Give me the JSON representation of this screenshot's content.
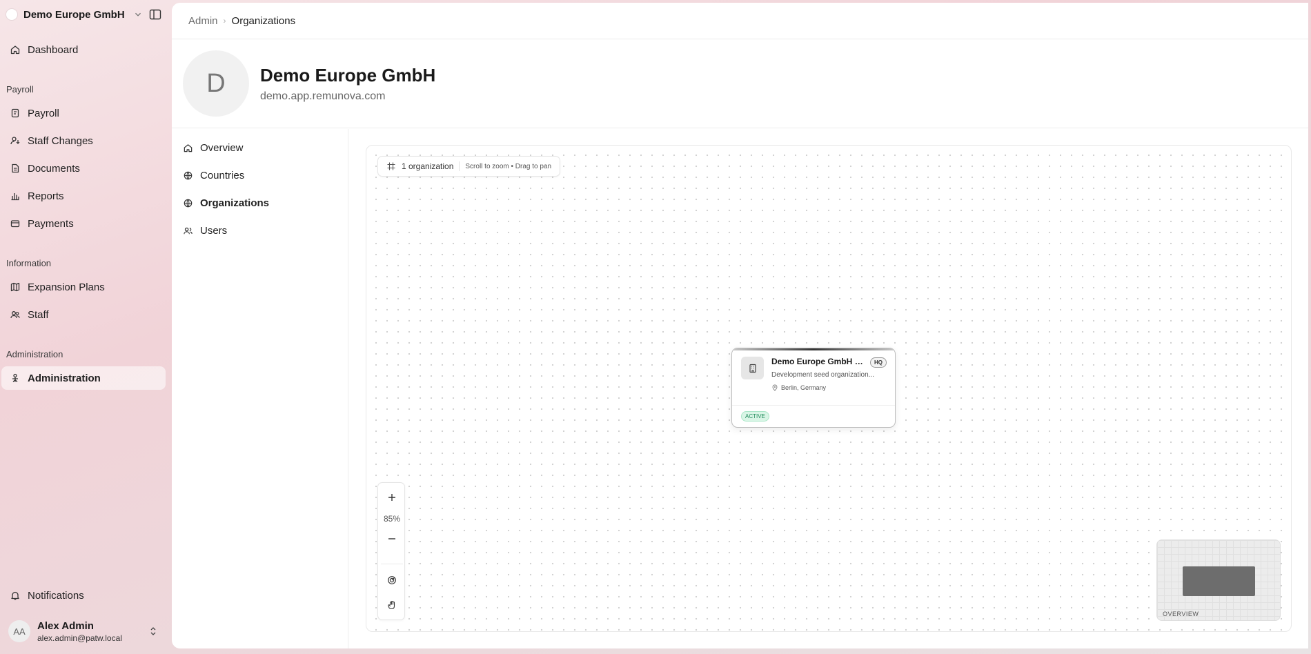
{
  "sidebar": {
    "org_name": "Demo Europe GmbH",
    "items_top": [
      {
        "label": "Dashboard",
        "icon": "home-icon"
      }
    ],
    "section_payroll": "Payroll",
    "items_payroll": [
      {
        "label": "Payroll",
        "icon": "receipt-icon"
      },
      {
        "label": "Staff Changes",
        "icon": "user-change-icon"
      },
      {
        "label": "Documents",
        "icon": "document-icon"
      },
      {
        "label": "Reports",
        "icon": "chart-icon"
      },
      {
        "label": "Payments",
        "icon": "wallet-icon"
      }
    ],
    "section_information": "Information",
    "items_information": [
      {
        "label": "Expansion Plans",
        "icon": "map-icon"
      },
      {
        "label": "Staff",
        "icon": "users-icon"
      }
    ],
    "section_administration": "Administration",
    "items_administration": [
      {
        "label": "Administration",
        "icon": "admin-icon",
        "active": true
      }
    ],
    "notifications_label": "Notifications",
    "user": {
      "initials": "AA",
      "name": "Alex Admin",
      "email": "alex.admin@patw.local"
    }
  },
  "breadcrumb": {
    "root": "Admin",
    "current": "Organizations"
  },
  "header": {
    "avatar_letter": "D",
    "title": "Demo Europe GmbH",
    "subtitle": "demo.app.remunova.com"
  },
  "subnav": {
    "items": [
      {
        "label": "Overview",
        "icon": "home-icon"
      },
      {
        "label": "Countries",
        "icon": "globe-icon"
      },
      {
        "label": "Organizations",
        "icon": "globe-icon",
        "active": true
      },
      {
        "label": "Users",
        "icon": "users-icon"
      }
    ]
  },
  "canvas": {
    "count_label": "1 organization",
    "hint": "Scroll to zoom • Drag to pan",
    "zoom_level": "85%",
    "minimap_label": "OVERVIEW",
    "org_card": {
      "title": "Demo Europe GmbH G...",
      "badge": "HQ",
      "description": "Development seed organization...",
      "location": "Berlin, Germany",
      "status": "ACTIVE"
    }
  },
  "colors": {
    "accent_bg": "#f1d3d8",
    "status_green": "#1f8a5b"
  }
}
